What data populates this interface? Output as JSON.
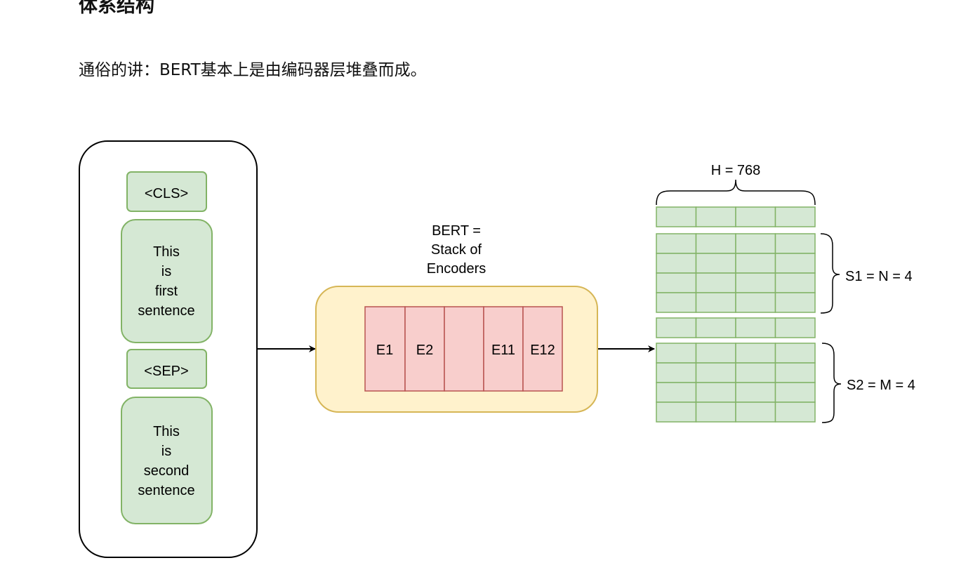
{
  "heading": "体系结构",
  "intro": "通俗的讲：BERT基本上是由编码器层堆叠而成。",
  "input": {
    "cls_label": "<CLS>",
    "sentence1_lines": [
      "This",
      "is",
      "first",
      "sentence"
    ],
    "sep_label": "<SEP>",
    "sentence2_lines": [
      "This",
      "is",
      "second",
      "sentence"
    ]
  },
  "bert": {
    "caption_lines": [
      "BERT =",
      "Stack of",
      "Encoders"
    ],
    "encoders": [
      "E1",
      "E2",
      "",
      "E11",
      "E12"
    ]
  },
  "output": {
    "hidden_label": "H = 768",
    "s1_label": "S1 = N = 4",
    "s2_label": "S2 = M = 4",
    "columns": 4,
    "cls_rows": 1,
    "s1_rows": 4,
    "sep_rows": 1,
    "s2_rows": 4
  },
  "colors": {
    "green_fill": "#d5e8d4",
    "green_stroke": "#82b366",
    "yellow_fill": "#fff2cc",
    "yellow_stroke": "#d6b656",
    "red_fill": "#f8cecc",
    "red_stroke": "#b85450",
    "ink": "#000000"
  }
}
